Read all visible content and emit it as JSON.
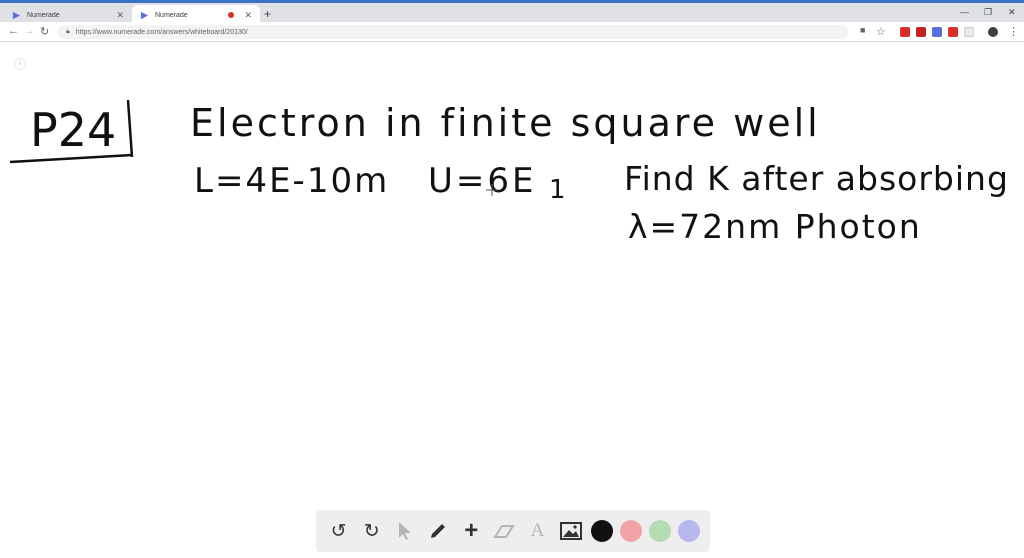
{
  "tabs": [
    {
      "title": "Numerade",
      "active": false
    },
    {
      "title": "Numerade",
      "active": true
    }
  ],
  "address": {
    "url": "https://www.numerade.com/answers/whiteboard/20130/"
  },
  "board": {
    "problem_label": "P24",
    "line1": "Electron in finite square well",
    "line2_a": "L=4E-10m",
    "line2_b": "U=6E",
    "line2_b_sub": "1",
    "line2_c": "Find K after absorbing",
    "line3": "λ=72nm Photon"
  },
  "tools": [
    {
      "name": "undo-icon",
      "glyph": "↺"
    },
    {
      "name": "redo-icon",
      "glyph": "↻"
    },
    {
      "name": "pointer-icon",
      "glyph": "➤"
    },
    {
      "name": "pencil-icon",
      "glyph": "✎"
    },
    {
      "name": "plus-icon",
      "glyph": "+"
    },
    {
      "name": "eraser-icon",
      "glyph": "▱"
    },
    {
      "name": "text-icon",
      "glyph": "A"
    },
    {
      "name": "image-icon",
      "glyph": "▨"
    }
  ],
  "colors": {
    "black": "#111111",
    "red": "#f2a3a8",
    "green": "#b5dcb5",
    "purple": "#b8b8ee",
    "accent": "#3a72c4"
  }
}
